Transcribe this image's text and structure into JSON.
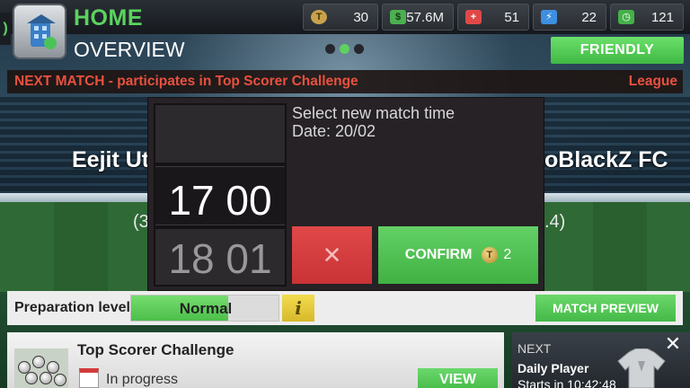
{
  "header": {
    "home_title": "HOME",
    "overview_title": "OVERVIEW",
    "left_tab_glyph": ")",
    "stats": [
      {
        "icon": "token-coin-icon",
        "value": "30",
        "color": "#c9a24b"
      },
      {
        "icon": "cash-icon",
        "value": "57.6M",
        "color": "#4caf50"
      },
      {
        "icon": "medical-cross-icon",
        "value": "51",
        "color": "#e04848"
      },
      {
        "icon": "energy-bolt-icon",
        "value": "22",
        "color": "#3d8fe0"
      },
      {
        "icon": "clock-icon",
        "value": "121",
        "color": "#46b04a"
      }
    ],
    "pager_dots": 3,
    "pager_active": 1,
    "friendly_label": "FRIENDLY"
  },
  "next_match": {
    "label": "NEXT MATCH - participates in Top Scorer Challenge",
    "competition": "League",
    "home_team": "Eejit Ut",
    "away_team": "oBlackZ FC",
    "home_rating": "(3",
    "away_rating": ".4)"
  },
  "modal": {
    "title": "Select new match time",
    "date": "Date: 20/02",
    "selected_time": "17 00",
    "next_time": "18 01",
    "cancel_glyph": "✕",
    "confirm_label": "CONFIRM",
    "confirm_cost": "2"
  },
  "preparation": {
    "label": "Preparation level:",
    "value": "Normal",
    "level_fraction": 0.66,
    "info_glyph": "i",
    "preview_label": "MATCH PREVIEW"
  },
  "challenge_card": {
    "title": "Top Scorer Challenge",
    "status": "In progress",
    "view_label": "VIEW"
  },
  "next_card": {
    "label": "NEXT",
    "name": "Daily Player",
    "time": "Starts in 10:42:48",
    "close_glyph": "✕"
  },
  "colors": {
    "accent_green": "#5bd35f",
    "alert_red": "#e8513f"
  }
}
